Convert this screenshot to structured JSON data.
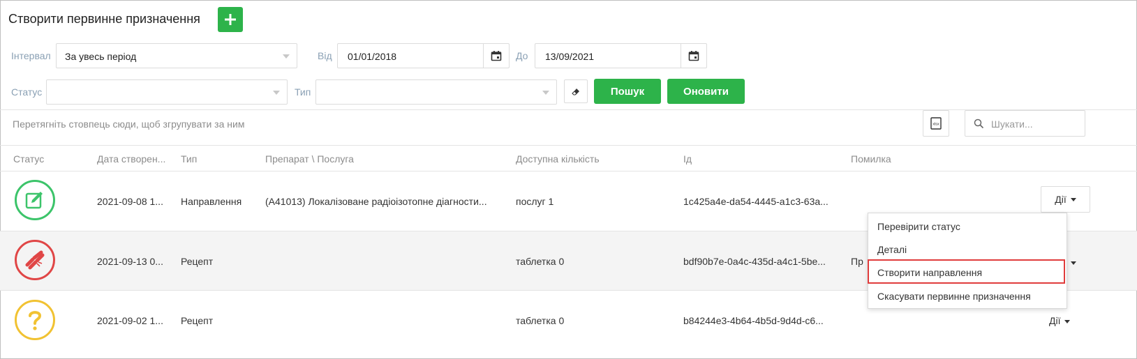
{
  "header": {
    "title": "Створити первинне призначення",
    "add_icon": "plus-icon"
  },
  "filters": {
    "interval_label": "Інтервал",
    "interval_value": "За увесь період",
    "from_label": "Від",
    "from_value": "01/01/2018",
    "to_label": "До",
    "to_value": "13/09/2021",
    "status_label": "Статус",
    "status_value": "",
    "type_label": "Тип",
    "type_value": "",
    "search_button": "Пошук",
    "refresh_button": "Оновити"
  },
  "grid": {
    "group_hint": "Перетягніть стовпець сюди, щоб згрупувати за ним",
    "search_placeholder": "Шукати...",
    "columns": [
      "Статус",
      "Дата створен...",
      "Тип",
      "Препарат \\ Послуга",
      "Доступна кількість",
      "Ід",
      "Помилка"
    ],
    "rows": [
      {
        "status": "edit",
        "date": "2021-09-08 1...",
        "type": "Направлення",
        "drug": "(A41013) Локалізоване радіоізотопне діагности...",
        "qty": "послуг 1",
        "id": "1c425a4e-da54-4445-a1c3-63a...",
        "error": "",
        "actions": "Дії"
      },
      {
        "status": "broken",
        "date": "2021-09-13 0...",
        "type": "Рецепт",
        "drug": "",
        "qty": "таблетка 0",
        "id": "bdf90b7e-0a4c-435d-a4c1-5be...",
        "error": "Пр",
        "actions": ""
      },
      {
        "status": "question",
        "date": "2021-09-02 1...",
        "type": "Рецепт",
        "drug": "",
        "qty": "таблетка 0",
        "id": "b84244e3-4b64-4b5d-9d4d-c6...",
        "error": "",
        "actions": "Дії"
      }
    ]
  },
  "menu": {
    "items": [
      "Перевірити статус",
      "Деталі",
      "Створити направлення",
      "Скасувати первинне призначення"
    ],
    "highlighted": 2
  },
  "colors": {
    "green": "#2db34a",
    "status_green": "#3cc46a",
    "status_red": "#e04646",
    "status_yellow": "#f1c232",
    "highlight": "#e03c3c"
  }
}
